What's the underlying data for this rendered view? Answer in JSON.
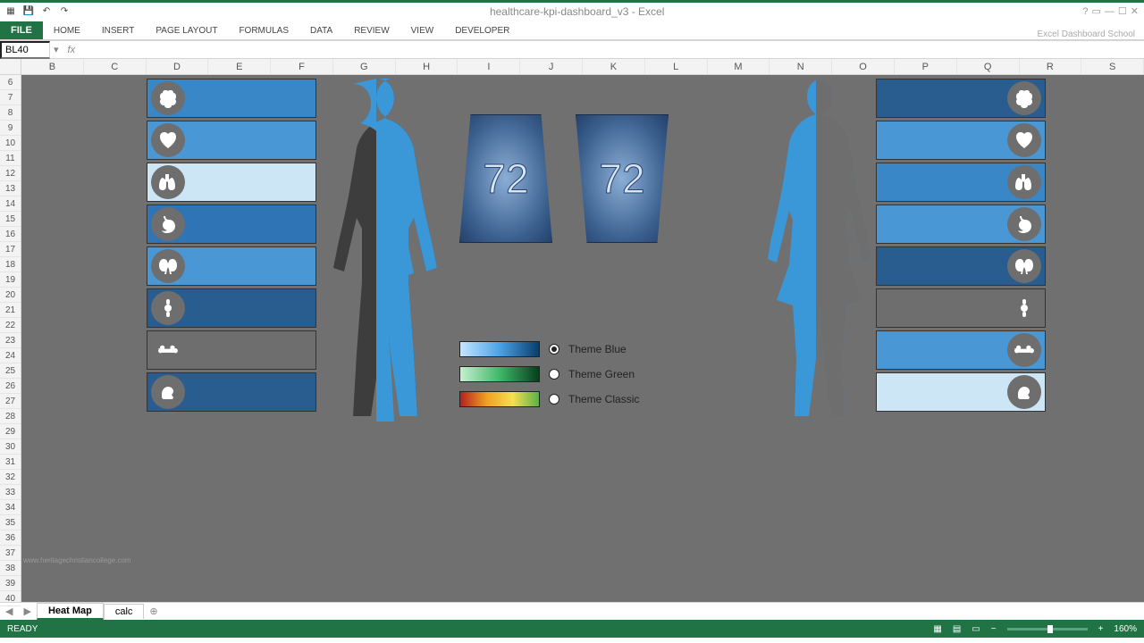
{
  "app": {
    "title": "healthcare-kpi-dashboard_v3 - Excel",
    "branding": "Excel Dashboard School"
  },
  "ribbon": {
    "file": "FILE",
    "tabs": [
      "HOME",
      "INSERT",
      "PAGE LAYOUT",
      "FORMULAS",
      "DATA",
      "REVIEW",
      "VIEW",
      "DEVELOPER"
    ]
  },
  "namebox": "BL40",
  "fx_label": "fx",
  "columns": [
    "B",
    "C",
    "D",
    "E",
    "F",
    "G",
    "H",
    "I",
    "J",
    "K",
    "L",
    "M",
    "N",
    "O",
    "P",
    "Q",
    "R",
    "S"
  ],
  "rows_start": 6,
  "rows_end": 40,
  "panels": {
    "left_value": "72",
    "right_value": "72"
  },
  "themes": [
    {
      "label": "Theme Blue",
      "selected": true,
      "key": "blue"
    },
    {
      "label": "Theme Green",
      "selected": false,
      "key": "green"
    },
    {
      "label": "Theme Classic",
      "selected": false,
      "key": "classic"
    }
  ],
  "organs_left": [
    {
      "name": "brain",
      "color": "#3a87c8"
    },
    {
      "name": "heart",
      "color": "#4a97d6"
    },
    {
      "name": "lungs",
      "color": "#cde6f5"
    },
    {
      "name": "stomach",
      "color": "#2f75b5"
    },
    {
      "name": "kidneys",
      "color": "#4a97d6"
    },
    {
      "name": "joint",
      "color": "#2a5d8f"
    },
    {
      "name": "bone",
      "color": "#6e6e6e"
    },
    {
      "name": "foot",
      "color": "#2a5d8f"
    }
  ],
  "organs_right": [
    {
      "name": "brain",
      "color": "#2a5d8f"
    },
    {
      "name": "heart",
      "color": "#4a97d6"
    },
    {
      "name": "lungs",
      "color": "#3a87c8"
    },
    {
      "name": "stomach",
      "color": "#4a97d6"
    },
    {
      "name": "kidneys",
      "color": "#2a5d8f"
    },
    {
      "name": "joint",
      "color": "#6e6e6e"
    },
    {
      "name": "bone",
      "color": "#4a97d6"
    },
    {
      "name": "foot",
      "color": "#cde6f5"
    }
  ],
  "sheets": {
    "active": "Heat Map",
    "others": [
      "calc"
    ]
  },
  "status": {
    "state": "READY",
    "zoom": "160%"
  },
  "watermark": "www.heritagechristiancollege.com"
}
